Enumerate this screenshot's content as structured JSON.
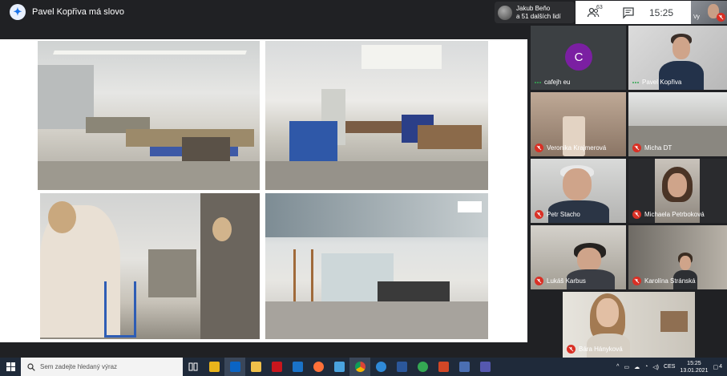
{
  "meeting": {
    "presenter_label": "Pavel Kopřiva má slovo",
    "joiner_line1": "Jakub Beňo",
    "joiner_line2": "a 51 dalších lidí",
    "participants_count": "63",
    "time": "15:25",
    "self_label": "Vy"
  },
  "participants": [
    {
      "name": "cafejh eu",
      "initial": "C"
    },
    {
      "name": "Pavel Kopřiva"
    },
    {
      "name": "Veronika Krajmerová"
    },
    {
      "name": "Micha DT"
    },
    {
      "name": "Petr Stacho"
    },
    {
      "name": "Michaela Petrboková"
    },
    {
      "name": "Lukáš Karbus"
    },
    {
      "name": "Karolína Stránská"
    },
    {
      "name": "Bára Hányková"
    }
  ],
  "taskbar": {
    "search_placeholder": "Sem zadejte hledaný výraz",
    "language": "CES",
    "time": "15:25",
    "date": "13.01.2021",
    "notification_count": "4"
  },
  "colors": {
    "accent": "#1a73e8",
    "muted_mic": "#d93025",
    "avatar_purple": "#7b1fa2",
    "speaking_green": "#34a853"
  },
  "icons": [
    "meet-logo-icon",
    "people-icon",
    "chat-icon",
    "mic-off-icon",
    "windows-start-icon",
    "search-icon",
    "task-view-icon",
    "volume-icon",
    "wifi-icon",
    "notification-icon"
  ]
}
